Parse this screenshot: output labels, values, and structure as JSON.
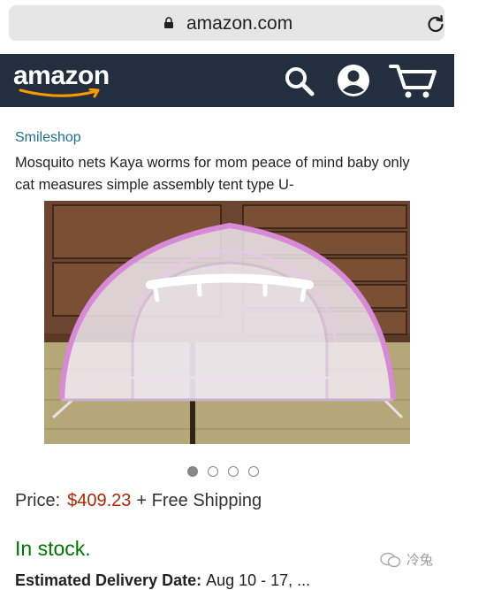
{
  "browser": {
    "url": "amazon.com"
  },
  "header": {
    "logo_text": "amazon"
  },
  "product": {
    "seller": "Smileshop",
    "title": "Mosquito nets Kaya worms for mom peace of mind baby only cat measures simple assembly tent type U-",
    "image_count": 4,
    "active_image": 1,
    "price_label": "Price:",
    "price": "$409.23",
    "shipping": "+ Free Shipping",
    "stock": "In stock.",
    "delivery_label": "Estimated Delivery Date:",
    "delivery_dates": "Aug 10 - 17, ..."
  },
  "watermark": {
    "text": "冷兔"
  },
  "colors": {
    "navbar": "#232f3e",
    "price": "#b12704",
    "stock": "#007600",
    "seller_link": "#1f6f8b"
  },
  "icons": [
    "lock-icon",
    "reload-icon",
    "search-icon",
    "account-icon",
    "cart-icon",
    "wechat-icon"
  ]
}
